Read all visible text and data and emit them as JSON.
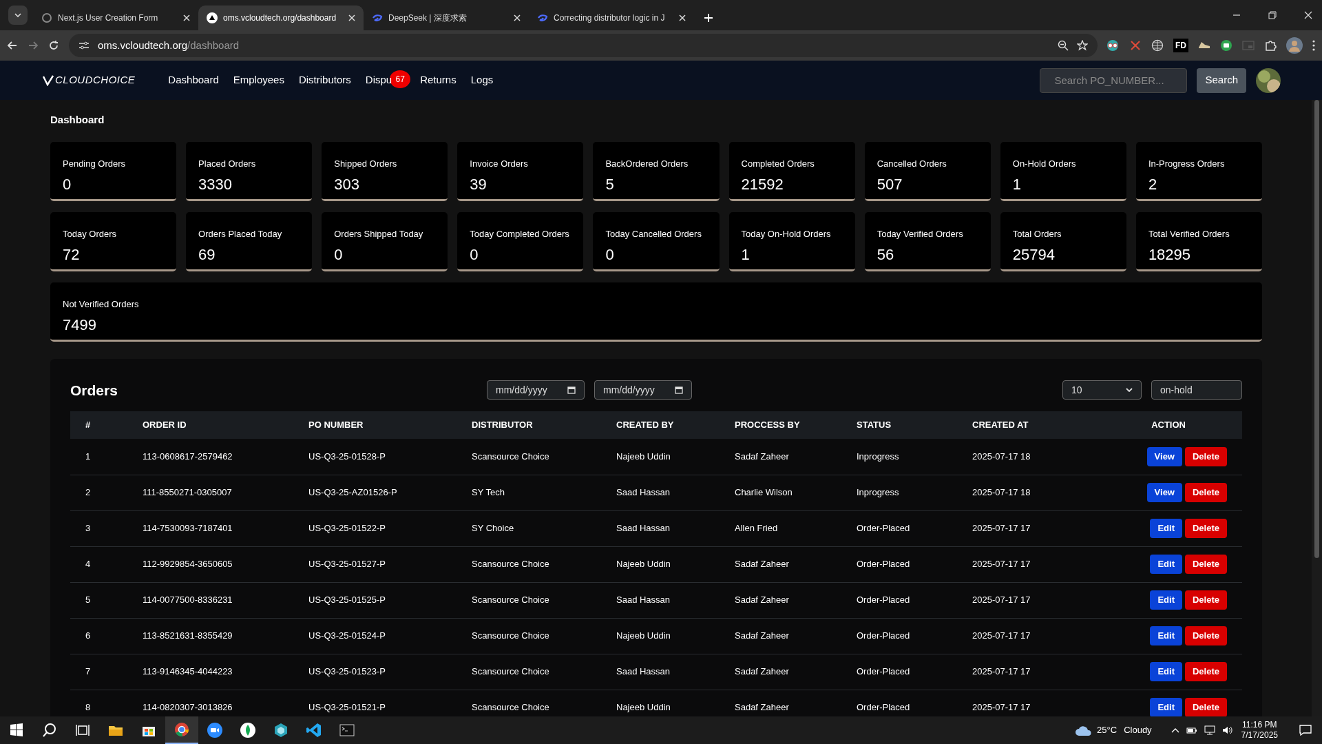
{
  "browser": {
    "tabs": [
      {
        "title": "Next.js User Creation Form",
        "selected": false,
        "kind": "circle"
      },
      {
        "title": "oms.vcloudtech.org/dashboard",
        "selected": true,
        "kind": "triangle"
      },
      {
        "title": "DeepSeek | 深度求索",
        "selected": false,
        "kind": "whale"
      },
      {
        "title": "Correcting distributor logic in J",
        "selected": false,
        "kind": "whale"
      }
    ],
    "address": {
      "host": "oms.vcloudtech.org",
      "path": "/dashboard"
    },
    "extensions": [
      {
        "kind": "glasses"
      },
      {
        "kind": "cross"
      },
      {
        "kind": "globe"
      },
      {
        "kind": "text",
        "label": "FD"
      },
      {
        "kind": "shoe"
      },
      {
        "kind": "robot"
      },
      {
        "kind": "pip"
      },
      {
        "kind": "puzzle"
      }
    ]
  },
  "app": {
    "brand": "CLOUDCHOICE",
    "nav": [
      {
        "label": "Dashboard"
      },
      {
        "label": "Employees"
      },
      {
        "label": "Distributors"
      },
      {
        "label": "Dispu",
        "badge": "67"
      },
      {
        "label": "Returns"
      },
      {
        "label": "Logs"
      }
    ],
    "search": {
      "placeholder": "Search PO_NUMBER...",
      "button": "Search"
    }
  },
  "page_title": "Dashboard",
  "stat_rows": [
    [
      {
        "label": "Pending Orders",
        "value": "0"
      },
      {
        "label": "Placed Orders",
        "value": "3330"
      },
      {
        "label": "Shipped Orders",
        "value": "303"
      },
      {
        "label": "Invoice Orders",
        "value": "39"
      },
      {
        "label": "BackOrdered Orders",
        "value": "5"
      },
      {
        "label": "Completed Orders",
        "value": "21592"
      },
      {
        "label": "Cancelled Orders",
        "value": "507"
      },
      {
        "label": "On-Hold Orders",
        "value": "1"
      },
      {
        "label": "In-Progress Orders",
        "value": "2"
      }
    ],
    [
      {
        "label": "Today Orders",
        "value": "72"
      },
      {
        "label": "Orders Placed Today",
        "value": "69"
      },
      {
        "label": "Orders Shipped Today",
        "value": "0"
      },
      {
        "label": "Today Completed Orders",
        "value": "0"
      },
      {
        "label": "Today Cancelled Orders",
        "value": "0"
      },
      {
        "label": "Today On-Hold Orders",
        "value": "1"
      },
      {
        "label": "Today Verified Orders",
        "value": "56"
      },
      {
        "label": "Total Orders",
        "value": "25794"
      },
      {
        "label": "Total Verified Orders",
        "value": "18295"
      }
    ],
    [
      {
        "label": "Not Verified Orders",
        "value": "7499"
      }
    ]
  ],
  "orders": {
    "title": "Orders",
    "date_from": {
      "placeholder": "mm/dd/yyyy"
    },
    "date_to": {
      "placeholder": "mm/dd/yyyy"
    },
    "page_size": "10",
    "status_filter": "on-hold",
    "table": {
      "columns": [
        "#",
        "ORDER ID",
        "PO NUMBER",
        "DISTRIBUTOR",
        "CREATED BY",
        "PROCCESS BY",
        "STATUS",
        "CREATED AT",
        "ACTION"
      ],
      "rows": [
        {
          "cells": [
            "1",
            "113-0608617-2579462",
            "US-Q3-25-01528-P",
            "Scansource Choice",
            "Najeeb Uddin",
            "Sadaf Zaheer",
            "Inprogress",
            "2025-07-17 18"
          ],
          "actions": [
            {
              "label": "View",
              "kind": "view"
            },
            {
              "label": "Delete",
              "kind": "delete"
            }
          ]
        },
        {
          "cells": [
            "2",
            "111-8550271-0305007",
            "US-Q3-25-AZ01526-P",
            "SY Tech",
            "Saad Hassan",
            "Charlie Wilson",
            "Inprogress",
            "2025-07-17 18"
          ],
          "actions": [
            {
              "label": "View",
              "kind": "view"
            },
            {
              "label": "Delete",
              "kind": "delete"
            }
          ]
        },
        {
          "cells": [
            "3",
            "114-7530093-7187401",
            "US-Q3-25-01522-P",
            "SY Choice",
            "Saad Hassan",
            "Allen Fried",
            "Order-Placed",
            "2025-07-17 17"
          ],
          "actions": [
            {
              "label": "Edit",
              "kind": "edit"
            },
            {
              "label": "Delete",
              "kind": "delete"
            }
          ]
        },
        {
          "cells": [
            "4",
            "112-9929854-3650605",
            "US-Q3-25-01527-P",
            "Scansource Choice",
            "Najeeb Uddin",
            "Sadaf Zaheer",
            "Order-Placed",
            "2025-07-17 17"
          ],
          "actions": [
            {
              "label": "Edit",
              "kind": "edit"
            },
            {
              "label": "Delete",
              "kind": "delete"
            }
          ]
        },
        {
          "cells": [
            "5",
            "114-0077500-8336231",
            "US-Q3-25-01525-P",
            "Scansource Choice",
            "Saad Hassan",
            "Sadaf Zaheer",
            "Order-Placed",
            "2025-07-17 17"
          ],
          "actions": [
            {
              "label": "Edit",
              "kind": "edit"
            },
            {
              "label": "Delete",
              "kind": "delete"
            }
          ]
        },
        {
          "cells": [
            "6",
            "113-8521631-8355429",
            "US-Q3-25-01524-P",
            "Scansource Choice",
            "Najeeb Uddin",
            "Sadaf Zaheer",
            "Order-Placed",
            "2025-07-17 17"
          ],
          "actions": [
            {
              "label": "Edit",
              "kind": "edit"
            },
            {
              "label": "Delete",
              "kind": "delete"
            }
          ]
        },
        {
          "cells": [
            "7",
            "113-9146345-4044223",
            "US-Q3-25-01523-P",
            "Scansource Choice",
            "Saad Hassan",
            "Sadaf Zaheer",
            "Order-Placed",
            "2025-07-17 17"
          ],
          "actions": [
            {
              "label": "Edit",
              "kind": "edit"
            },
            {
              "label": "Delete",
              "kind": "delete"
            }
          ]
        },
        {
          "cells": [
            "8",
            "114-0820307-3013826",
            "US-Q3-25-01521-P",
            "Scansource Choice",
            "Najeeb Uddin",
            "Sadaf Zaheer",
            "Order-Placed",
            "2025-07-17 17"
          ],
          "actions": [
            {
              "label": "Edit",
              "kind": "edit"
            },
            {
              "label": "Delete",
              "kind": "delete"
            }
          ]
        }
      ]
    }
  },
  "taskbar": {
    "apps": [
      {
        "kind": "folder",
        "selected": false
      },
      {
        "kind": "store",
        "selected": false
      },
      {
        "kind": "browser",
        "selected": true
      },
      {
        "kind": "meeting",
        "selected": false
      },
      {
        "kind": "leaf",
        "selected": false
      },
      {
        "kind": "hexagon",
        "selected": false
      },
      {
        "kind": "editor",
        "selected": false
      },
      {
        "kind": "terminal",
        "selected": false
      }
    ],
    "weather": {
      "temp": "25°C",
      "condition": "Cloudy"
    },
    "time": "11:16 PM",
    "date": "7/17/2025"
  }
}
